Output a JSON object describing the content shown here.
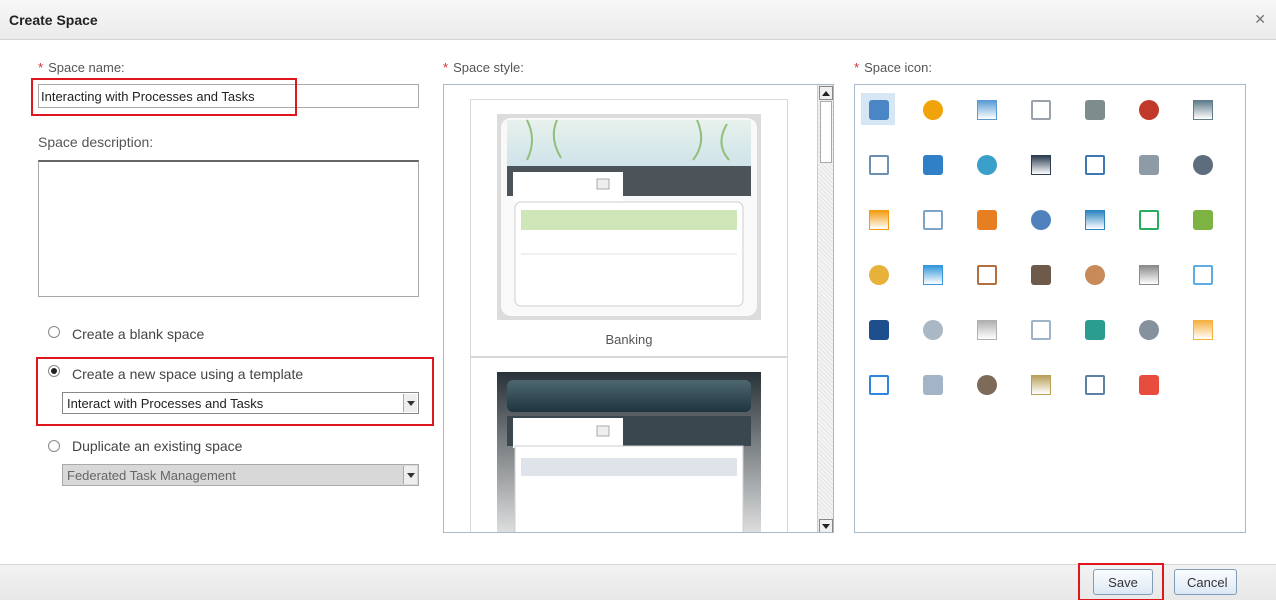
{
  "dialog": {
    "title": "Create Space",
    "close_glyph": "✕"
  },
  "form": {
    "space_name_label": "Space name:",
    "space_name_value": "Interacting with Processes and Tasks",
    "description_label": "Space description:",
    "required_mark": "*",
    "options": {
      "blank": "Create a blank space",
      "template": "Create a new space using a template",
      "duplicate": "Duplicate an existing space"
    },
    "selected_option": "template",
    "template_select_value": "Interact with Processes and Tasks",
    "duplicate_select_value": "Federated Task Management"
  },
  "style": {
    "label": "Space style:",
    "templates": [
      "Banking",
      ""
    ]
  },
  "icons": {
    "label": "Space icon:",
    "selected": "layout-icon",
    "items": [
      "layout-icon",
      "warning-icon",
      "bar-chart-icon",
      "service-bell-icon",
      "briefcase-icon",
      "books-icon",
      "calculator-icon",
      "car-icon",
      "clock-icon",
      "workflow-icon",
      "phone-icon",
      "monitor-icon",
      "id-card-icon",
      "database-icon",
      "pie-chart-icon",
      "document-icon",
      "rss-feed-icon",
      "columns-icon",
      "globe-server-icon",
      "network-icon",
      "home-icon",
      "area-chart-icon",
      "globe-icon",
      "user-icon",
      "user-female-icon",
      "user-bald-icon",
      "user-list-icon",
      "basket-icon",
      "laptop-icon",
      "line-chart-icon",
      "file-icon",
      "mail-icon",
      "org-chart-icon",
      "cart-icon",
      "shopping-bag-icon",
      "column-chart-icon",
      "table-icon",
      "users-icon",
      "clipboard-icon",
      "truck-icon",
      "compass-icon"
    ]
  },
  "footer": {
    "save": "Save",
    "cancel": "Cancel"
  },
  "colors": {
    "required": "#d32f2f",
    "highlight": "#e0161e"
  }
}
